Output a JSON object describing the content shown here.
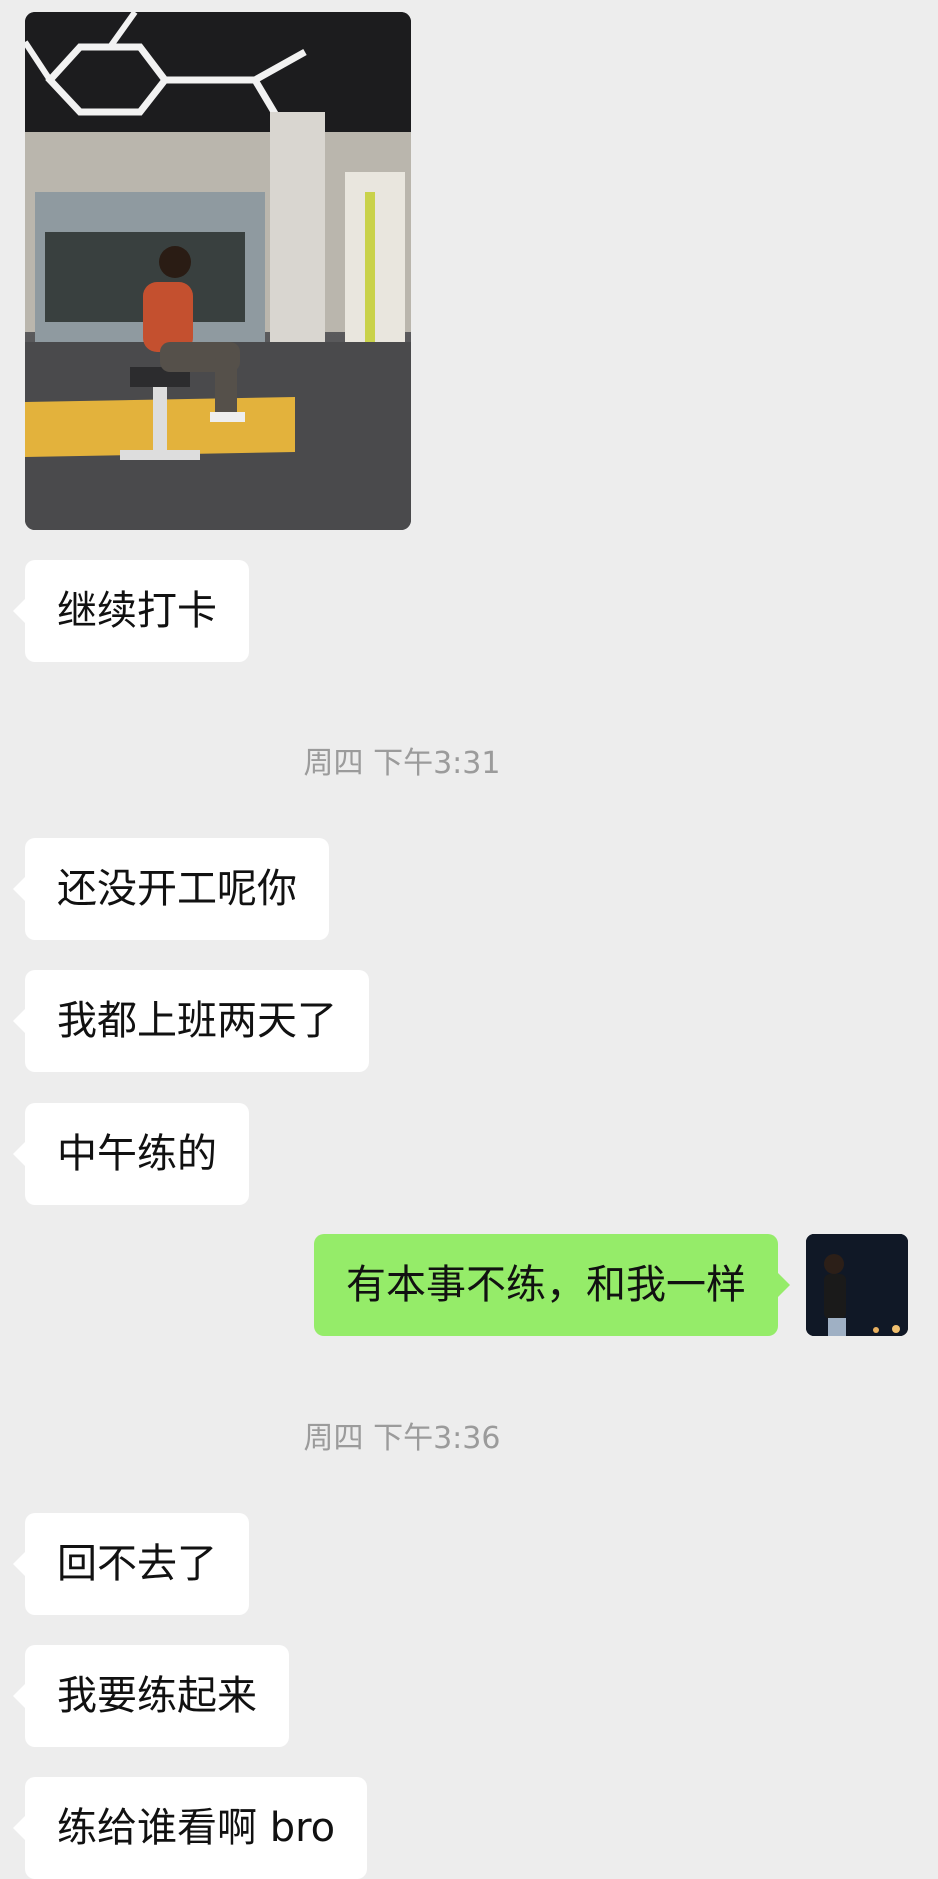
{
  "messages": [
    {
      "type": "image",
      "from": "other",
      "alt": "gym-selfie-photo"
    },
    {
      "type": "text",
      "from": "other",
      "text": "继续打卡"
    },
    {
      "type": "timestamp",
      "text": "周四 下午3:31"
    },
    {
      "type": "text",
      "from": "other",
      "text": "还没开工呢你"
    },
    {
      "type": "text",
      "from": "other",
      "text": "我都上班两天了"
    },
    {
      "type": "text",
      "from": "other",
      "text": "中午练的"
    },
    {
      "type": "text",
      "from": "me",
      "text": "有本事不练，和我一样"
    },
    {
      "type": "timestamp",
      "text": "周四 下午3:36"
    },
    {
      "type": "text",
      "from": "other",
      "text": "回不去了"
    },
    {
      "type": "text",
      "from": "other",
      "text": "我要练起来"
    },
    {
      "type": "text",
      "from": "other",
      "text": "练给谁看啊 bro"
    }
  ],
  "colors": {
    "background": "#ededed",
    "received_bubble": "#ffffff",
    "sent_bubble": "#95ec69",
    "timestamp_text": "#9b9b9b"
  },
  "icons": {
    "avatar": "user-avatar-photo"
  }
}
